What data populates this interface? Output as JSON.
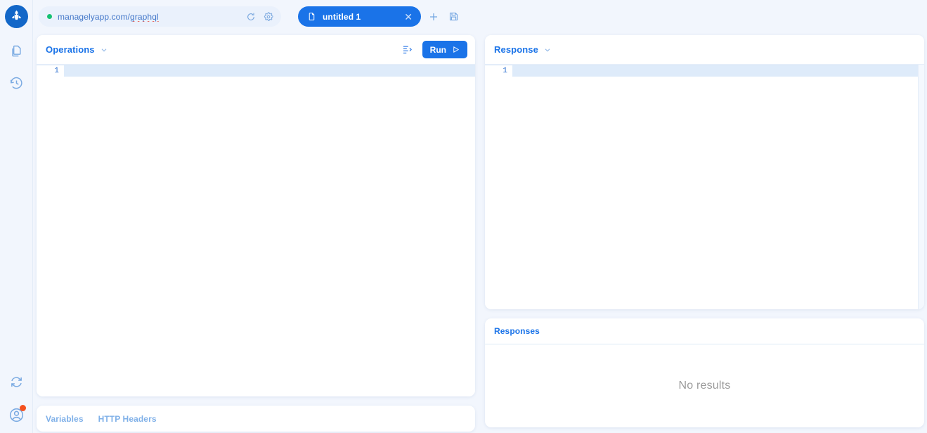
{
  "app": {
    "logo_icon": "altair-rocket-logo",
    "background_color": "#f2f6fd",
    "accent_color": "#1a73e8"
  },
  "rail": {
    "items": [
      {
        "name": "documents",
        "icon": "documents-copy-icon"
      },
      {
        "name": "history",
        "icon": "history-clock-icon"
      }
    ],
    "bottom_items": [
      {
        "name": "sync",
        "icon": "refresh-sync-icon"
      },
      {
        "name": "account",
        "icon": "user-account-icon",
        "badge": true
      }
    ]
  },
  "topbar": {
    "url": {
      "value": "managelyapp.com/graphql",
      "prefix": "managelyapp.com/",
      "misspelled": "graphql",
      "placeholder": "Enter URL",
      "status_dot_color": "#16c172",
      "reload_icon": "reload-icon",
      "settings_icon": "gear-icon"
    },
    "tabs": [
      {
        "label": "untitled 1",
        "file_icon": "file-icon",
        "close_icon": "close-icon",
        "active": true
      }
    ],
    "add_tab_icon": "plus-icon",
    "save_icon": "floppy-save-icon"
  },
  "operations": {
    "title": "Operations",
    "chevron_icon": "chevron-down-icon",
    "prettify_icon": "prettify-format-icon",
    "run_label": "Run",
    "run_icon": "play-icon",
    "editor": {
      "lines": [
        "1"
      ],
      "content": ""
    }
  },
  "response": {
    "title": "Response",
    "chevron_icon": "chevron-down-icon",
    "editor": {
      "lines": [
        "1"
      ],
      "content": ""
    }
  },
  "responses": {
    "title": "Responses",
    "empty_text": "No results"
  },
  "variables": {
    "tabs": [
      {
        "label": "Variables"
      },
      {
        "label": "HTTP Headers"
      }
    ]
  }
}
